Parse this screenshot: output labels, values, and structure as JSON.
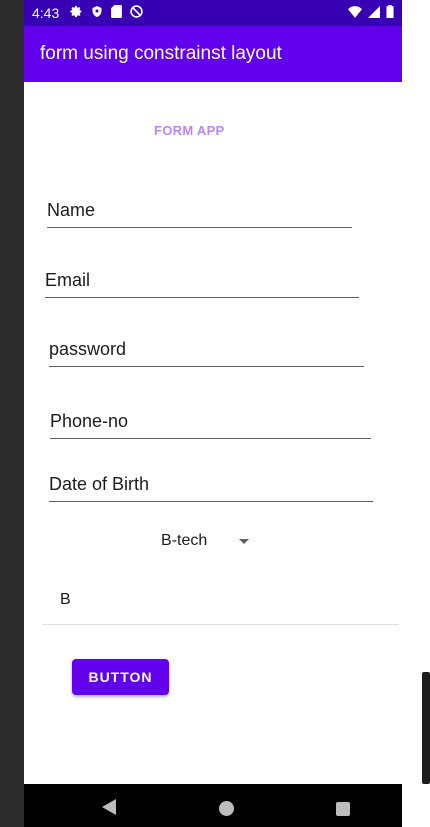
{
  "status_bar": {
    "time": "4:43",
    "left_icons": [
      "gear-icon",
      "shield-icon",
      "sd-card-icon",
      "no-disturb-icon"
    ],
    "right_icons": [
      "wifi-icon",
      "signal-icon",
      "battery-icon"
    ]
  },
  "app_bar": {
    "title": "form using constrainst layout",
    "color": "#6200ee",
    "status_color": "#3700b3"
  },
  "form": {
    "heading": "FORM APP",
    "heading_color": "#bb86fc",
    "fields": {
      "name": "Name",
      "email": "Email",
      "password": "password",
      "phone": "Phone-no",
      "dob": "Date of Birth"
    },
    "spinner_value": "B-tech",
    "text_value": "B",
    "button_label": "BUTTON"
  },
  "nav_bar": {
    "icons": [
      "back-icon",
      "home-icon",
      "recent-apps-icon"
    ]
  }
}
